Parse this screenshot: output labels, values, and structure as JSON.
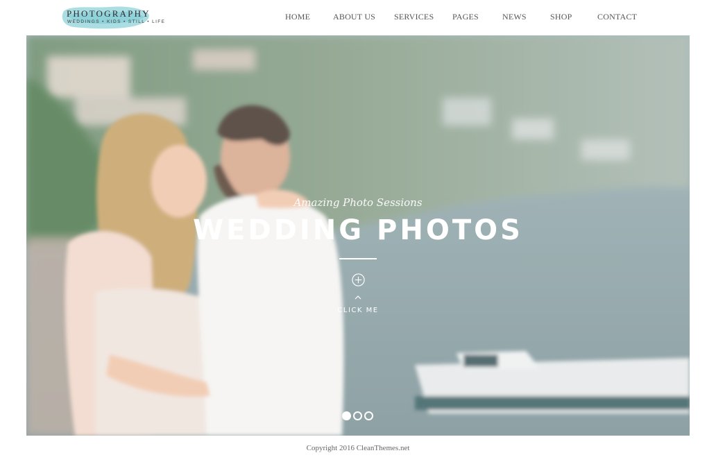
{
  "header": {
    "logo": {
      "title": "PHOTOGRAPHY",
      "tagline": "WEDDINGS • KIDS • STILL • LIFE",
      "splash_color": "#8fd3da"
    },
    "nav": [
      {
        "label": "HOME"
      },
      {
        "label": "ABOUT US"
      },
      {
        "label": "SERVICES"
      },
      {
        "label": "PAGES"
      },
      {
        "label": "NEWS"
      },
      {
        "label": "SHOP"
      },
      {
        "label": "CONTACT"
      }
    ]
  },
  "hero": {
    "subtitle": "Amazing Photo Sessions",
    "title": "WEDDING PHOTOS",
    "plus_icon": "plus-circle-icon",
    "caret_icon": "chevron-up-icon",
    "cta_label": "CLICK ME",
    "slides": {
      "count": 3,
      "active_index": 0
    }
  },
  "footer": {
    "copyright": "Copyright 2016 CleanThemes.net"
  }
}
